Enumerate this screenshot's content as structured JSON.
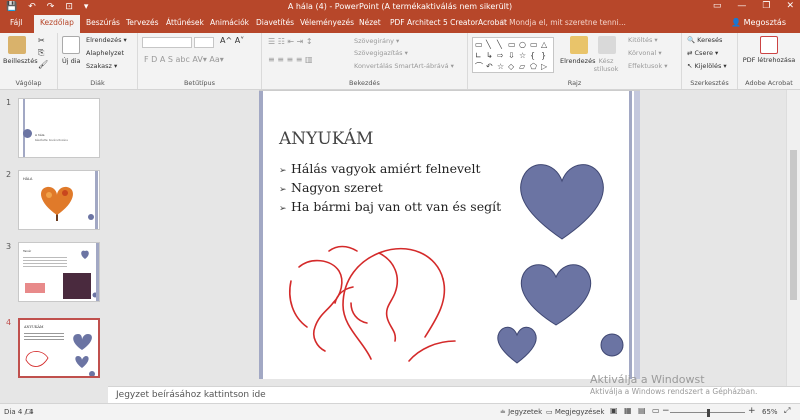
{
  "titlebar": {
    "title": "A hála (4) - PowerPoint (A termékaktiválás nem sikerült)",
    "qat": [
      "💾",
      "↶",
      "↷",
      "⊡",
      "▾"
    ],
    "win_buttons": [
      "▭",
      "—",
      "❐",
      "✕"
    ]
  },
  "tabs": [
    "Fájl",
    "Kezdőlap",
    "Beszúrás",
    "Tervezés",
    "Áttűnések",
    "Animációk",
    "Diavetítés",
    "Véleményezés",
    "Nézet",
    "PDF Architect 5 Creator",
    "Acrobat"
  ],
  "tell_me": "♡ Mondja el, mit szeretne tenni...",
  "share": "👤 Megosztás",
  "ribbon": {
    "clipboard": {
      "paste": "Beillesztés",
      "group": "Vágólap"
    },
    "slides": {
      "new_slide": "Új dia",
      "layout": "Elrendezés ▾",
      "reset": "Alaphelyzet",
      "section": "Szakasz ▾",
      "group": "Diák"
    },
    "font": {
      "bold_italic": "F  D  A  S  abc  AV▾  Aa▾",
      "grow": "A^  A˅",
      "group": "Betűtípus"
    },
    "paragraph": {
      "text_direction": "Szövegirány ▾",
      "align_text": "Szövegigazítás ▾",
      "smartart": "Konvertálás SmartArt-ábrává ▾",
      "group": "Bekezdés"
    },
    "drawing": {
      "arrange": "Elrendezés",
      "quick_styles": "Kész stílusok",
      "fill": "Kitöltés ▾",
      "outline": "Körvonal ▾",
      "effects": "Effektusok ▾",
      "group": "Rajz"
    },
    "editing": {
      "find": "Keresés",
      "replace": "Csere ▾",
      "select": "Kijelölés ▾",
      "group": "Szerkesztés"
    },
    "acrobat": {
      "pdf": "PDF létrehozása",
      "group": "Adobe Acrobat"
    }
  },
  "thumbnails": [
    {
      "num": "1",
      "title": "A hála",
      "subtitle": "Készítette: Kovács Roxána"
    },
    {
      "num": "2",
      "title": "HÁLA"
    },
    {
      "num": "3",
      "title": "Tanár"
    },
    {
      "num": "4",
      "title": "ANYUKÁM"
    }
  ],
  "slide": {
    "title": "ANYUKÁM",
    "bullets": [
      "Hálás vagyok amiért felnevelt",
      "Nagyon szeret",
      "Ha bármi baj van ott van és segít"
    ]
  },
  "notes_placeholder": "Jegyzet beírásához kattintson ide",
  "activation": {
    "line1": "Aktiválja a Windowst",
    "line2": "Aktiválja a Windows rendszert a Gépházban."
  },
  "status": {
    "slide_count": "Dia 4 / 4",
    "notes": "≐ Jegyzetek",
    "comments": "▭ Megjegyzések",
    "zoom": "65%",
    "minus": "−",
    "plus": "+"
  },
  "colors": {
    "accent": "#b7472a",
    "heart": "#6b74a3",
    "heart_stroke": "#3f4772",
    "line_art": "#d42a2a"
  }
}
